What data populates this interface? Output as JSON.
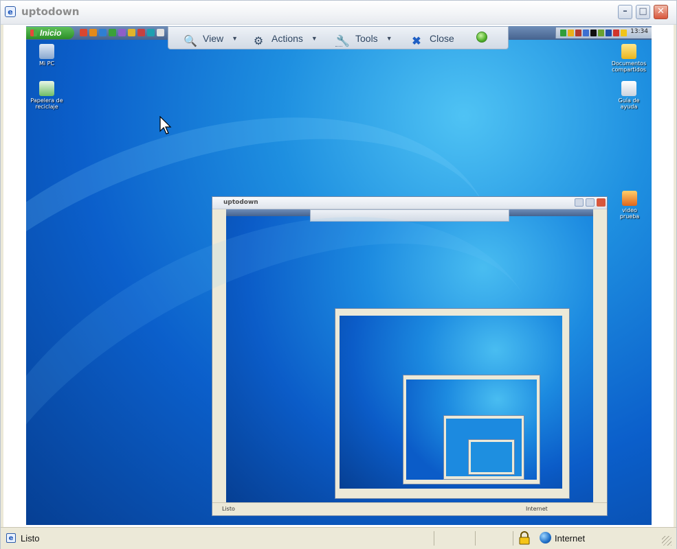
{
  "window": {
    "title": "uptodown",
    "app_icon": "ie-icon",
    "controls": {
      "minimize": "minimize-icon",
      "maximize": "maximize-icon",
      "close": "close-icon"
    }
  },
  "remote_desktop": {
    "taskbar": {
      "start_label": "Inicio",
      "clock": "13:34",
      "quick_launch_colors": [
        "#d9462f",
        "#e38a1a",
        "#2f7fd3",
        "#3aa13a",
        "#8e5ec9",
        "#e0b42a",
        "#c74040",
        "#1f9fb0",
        "#e0e0e0"
      ],
      "tray_colors": [
        "#2f9d3a",
        "#e9b019",
        "#b23a2e",
        "#3d6fd1",
        "#111111",
        "#6aa12f",
        "#1f4ea8",
        "#d0342c",
        "#f0c419"
      ]
    },
    "toolbar": {
      "view_label": "View",
      "actions_label": "Actions",
      "tools_label": "Tools",
      "close_label": "Close"
    },
    "icons": [
      {
        "name": "my-pc-icon",
        "label": "Mi PC"
      },
      {
        "name": "recycle-bin-icon",
        "label": "Papelera de reciclaje"
      },
      {
        "name": "shared-docs-icon",
        "label": "Documentos compartidos"
      },
      {
        "name": "help-file-icon",
        "label": "Guía de ayuda"
      },
      {
        "name": "video-file-icon",
        "label": "video prueba"
      }
    ]
  },
  "nested": {
    "window_title": "uptodown",
    "status_text": "Listo",
    "zone_text": "Internet"
  },
  "statusbar": {
    "status_text": "Listo",
    "zone_text": "Internet"
  },
  "colors": {
    "desktop_blue": "#0b5fcb",
    "start_green": "#2c8f28",
    "close_red": "#d8573c"
  }
}
